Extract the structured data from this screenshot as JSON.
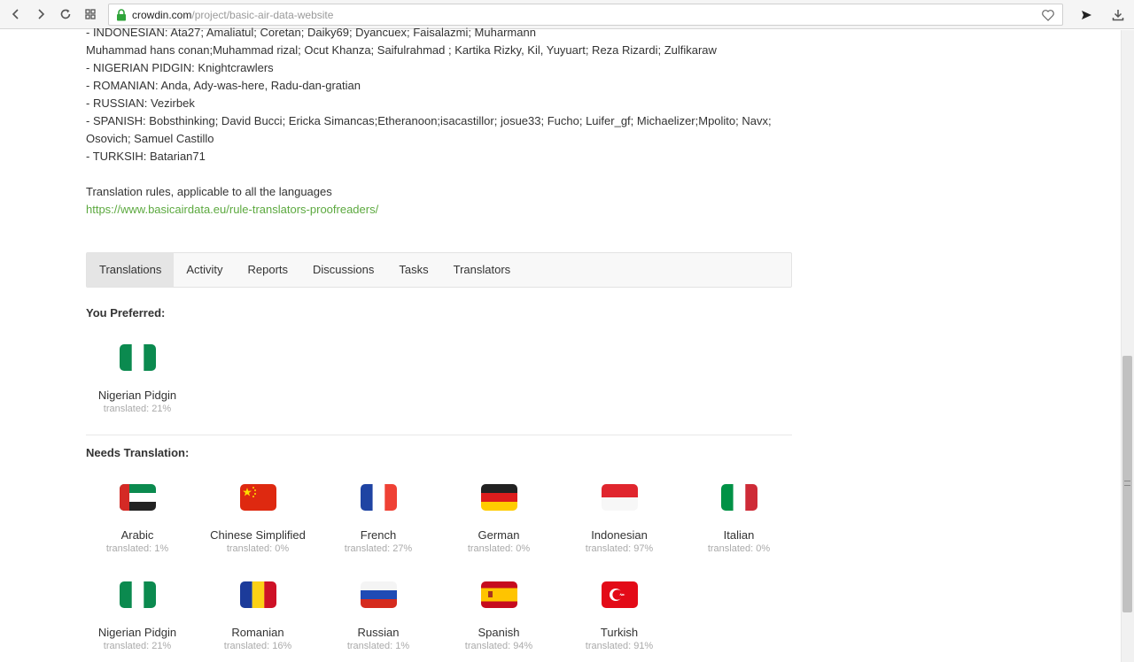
{
  "browser": {
    "url_host": "crowdin.com",
    "url_path": "/project/basic-air-data-website"
  },
  "description": {
    "lines": [
      "- INDONESIAN: Ata27; Amaliatul; Coretan; Daiky69; Dyancuex; Faisalazmi; Muharmann",
      "Muhammad hans conan;Muhammad rizal; Ocut Khanza; Saifulrahmad ; Kartika Rizky, Kil, Yuyuart; Reza Rizardi; Zulfikaraw",
      "- NIGERIAN PIDGIN: Knightcrawlers",
      "- ROMANIAN: Anda, Ady-was-here, Radu-dan-gratian",
      "- RUSSIAN: Vezirbek",
      "- SPANISH: Bobsthinking; David Bucci; Ericka Simancas;Etheranoon;isacastillor; josue33; Fucho; Luifer_gf; Michaelizer;Mpolito; Navx;",
      "Osovich; Samuel Castillo",
      "- TURKSIH: Batarian71"
    ],
    "rules_label": "Translation rules, applicable to all the languages",
    "rules_link": "https://www.basicairdata.eu/rule-translators-proofreaders/"
  },
  "tabs": [
    "Translations",
    "Activity",
    "Reports",
    "Discussions",
    "Tasks",
    "Translators"
  ],
  "preferred": {
    "title": "You Preferred:",
    "items": [
      {
        "name": "Nigerian Pidgin",
        "stat": "translated: 21%",
        "flag": "nigeria-flag-icon"
      }
    ]
  },
  "needs": {
    "title": "Needs Translation:",
    "items": [
      {
        "name": "Arabic",
        "stat": "translated: 1%",
        "flag": "uae-flag-icon"
      },
      {
        "name": "Chinese Simplified",
        "stat": "translated: 0%",
        "flag": "china-flag-icon"
      },
      {
        "name": "French",
        "stat": "translated: 27%",
        "flag": "france-flag-icon"
      },
      {
        "name": "German",
        "stat": "translated: 0%",
        "flag": "germany-flag-icon"
      },
      {
        "name": "Indonesian",
        "stat": "translated: 97%",
        "flag": "indonesia-flag-icon"
      },
      {
        "name": "Italian",
        "stat": "translated: 0%",
        "flag": "italy-flag-icon"
      },
      {
        "name": "Nigerian Pidgin",
        "stat": "translated: 21%",
        "flag": "nigeria-flag-icon"
      },
      {
        "name": "Romanian",
        "stat": "translated: 16%",
        "flag": "romania-flag-icon"
      },
      {
        "name": "Russian",
        "stat": "translated: 1%",
        "flag": "russia-flag-icon"
      },
      {
        "name": "Spanish",
        "stat": "translated: 94%",
        "flag": "spain-flag-icon"
      },
      {
        "name": "Turkish",
        "stat": "translated: 91%",
        "flag": "turkey-flag-icon"
      }
    ]
  },
  "colors": {
    "link_green": "#5ca93f",
    "nigeria_green": "#0b8a4f",
    "uae_red": "#d42a25",
    "uae_green": "#0b8a4f",
    "china_red": "#de2910",
    "china_yellow": "#ffde00",
    "france_blue": "#1f44a3",
    "france_red": "#ef4135",
    "germany_red": "#dd1d1d",
    "germany_gold": "#ffcc00",
    "indonesia_red": "#e0262e",
    "italy_green": "#009246",
    "italy_red": "#ce2b37",
    "romania_blue": "#1c3b9a",
    "romania_yellow": "#fcd116",
    "romania_red": "#ce1126",
    "russia_blue": "#1f4bb5",
    "russia_red": "#d52b1e",
    "spain_red": "#c60b1e",
    "spain_yellow": "#ffc400",
    "turkey_red": "#e30a17"
  }
}
